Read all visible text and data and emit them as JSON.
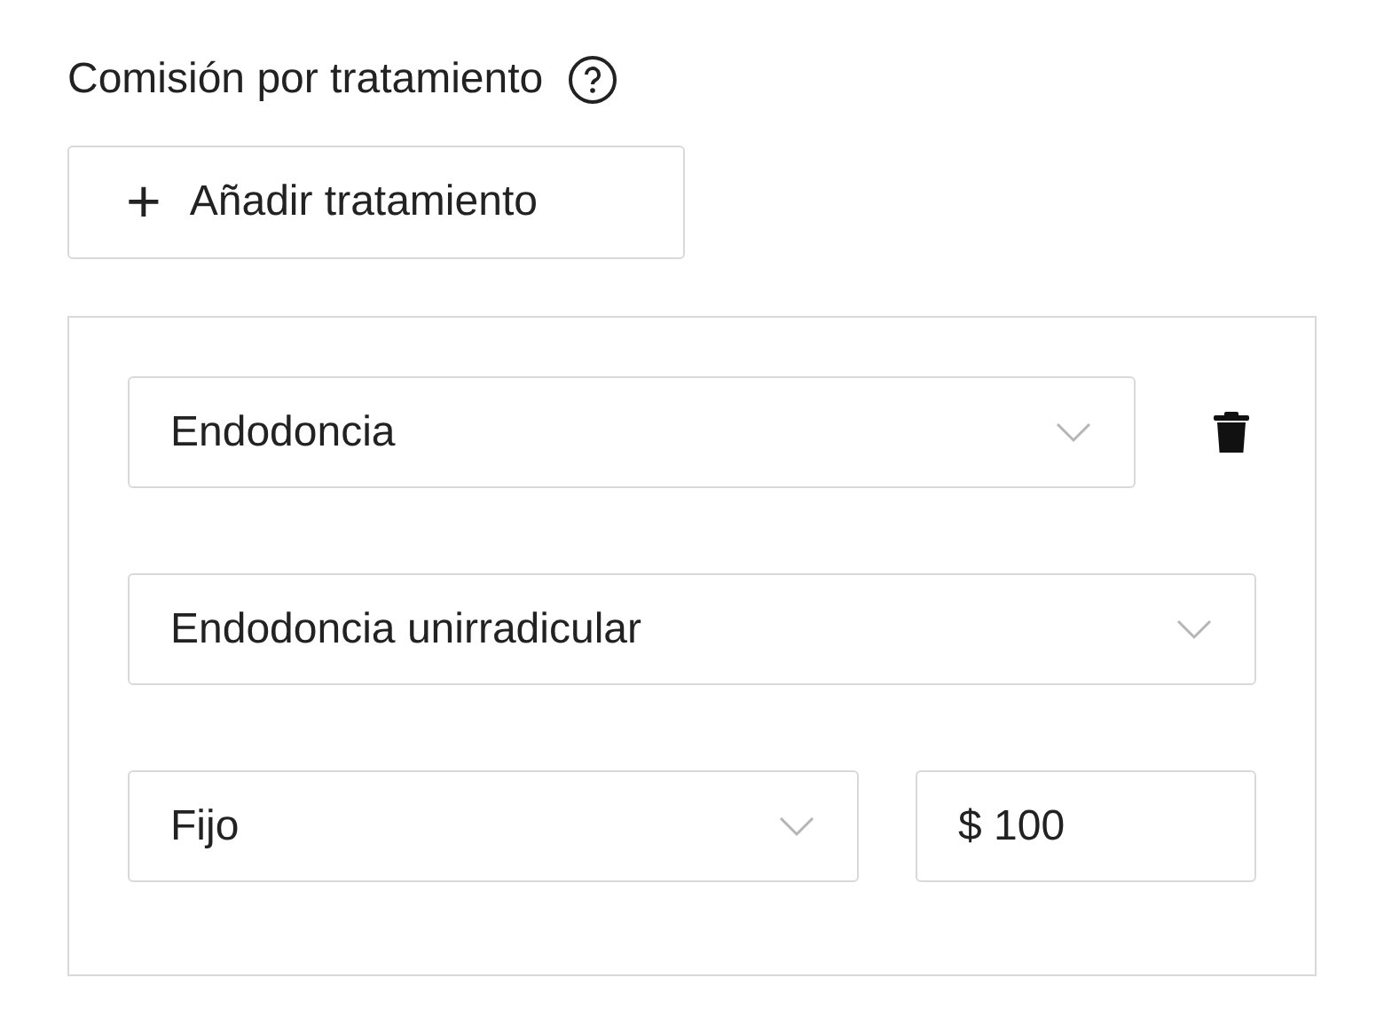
{
  "section": {
    "title": "Comisión por tratamiento"
  },
  "add_button": {
    "icon": "+",
    "label": "Añadir tratamiento"
  },
  "treatment": {
    "category": "Endodoncia",
    "procedure": "Endodoncia unirradicular",
    "commission_type": "Fijo",
    "amount": "$ 100"
  }
}
